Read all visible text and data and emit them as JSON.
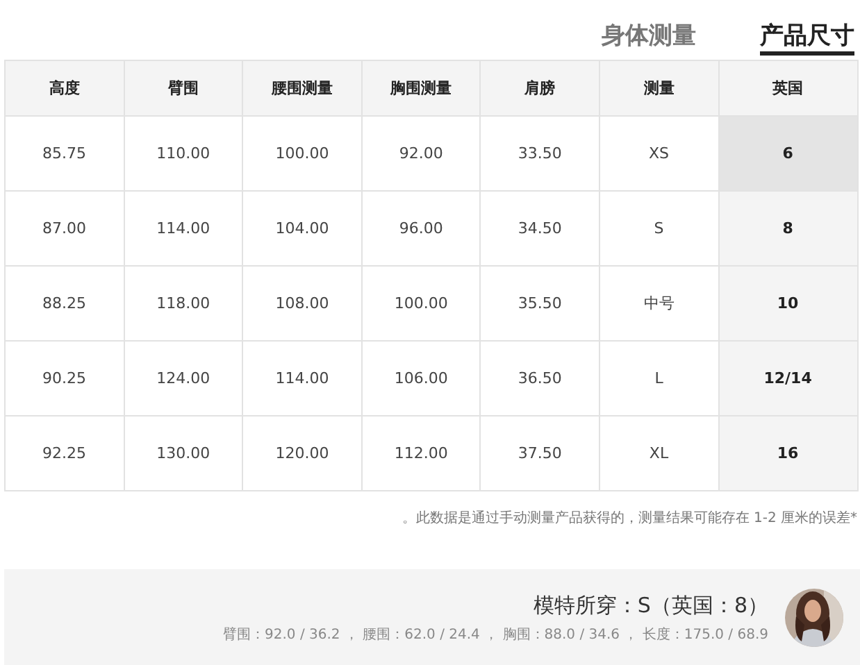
{
  "tabs": [
    {
      "label": "身体测量",
      "selected": false
    },
    {
      "label": "产品尺寸",
      "selected": true
    }
  ],
  "table": {
    "columns": [
      "高度",
      "臂围",
      "腰围测量",
      "胸围测量",
      "肩膀",
      "测量",
      "英国"
    ],
    "rows": [
      {
        "cells": [
          "85.75",
          "110.00",
          "100.00",
          "92.00",
          "33.50",
          "XS",
          "6"
        ],
        "selected": true
      },
      {
        "cells": [
          "87.00",
          "114.00",
          "104.00",
          "96.00",
          "34.50",
          "S",
          "8"
        ],
        "selected": false
      },
      {
        "cells": [
          "88.25",
          "118.00",
          "108.00",
          "100.00",
          "35.50",
          "中号",
          "10"
        ],
        "selected": false
      },
      {
        "cells": [
          "90.25",
          "124.00",
          "114.00",
          "106.00",
          "36.50",
          "L",
          "12/14"
        ],
        "selected": false
      },
      {
        "cells": [
          "92.25",
          "130.00",
          "120.00",
          "112.00",
          "37.50",
          "XL",
          "16"
        ],
        "selected": false
      }
    ]
  },
  "note": "。此数据是通过手动测量产品获得的，测量结果可能存在 1-2 厘米的误差*",
  "model": {
    "title": "模特所穿：S（英国：8）",
    "measurements": "臂围：92.0 / 36.2 ， 腰围：62.0 / 24.4 ， 胸围：88.0 / 34.6 ， 长度：175.0 / 68.9"
  }
}
